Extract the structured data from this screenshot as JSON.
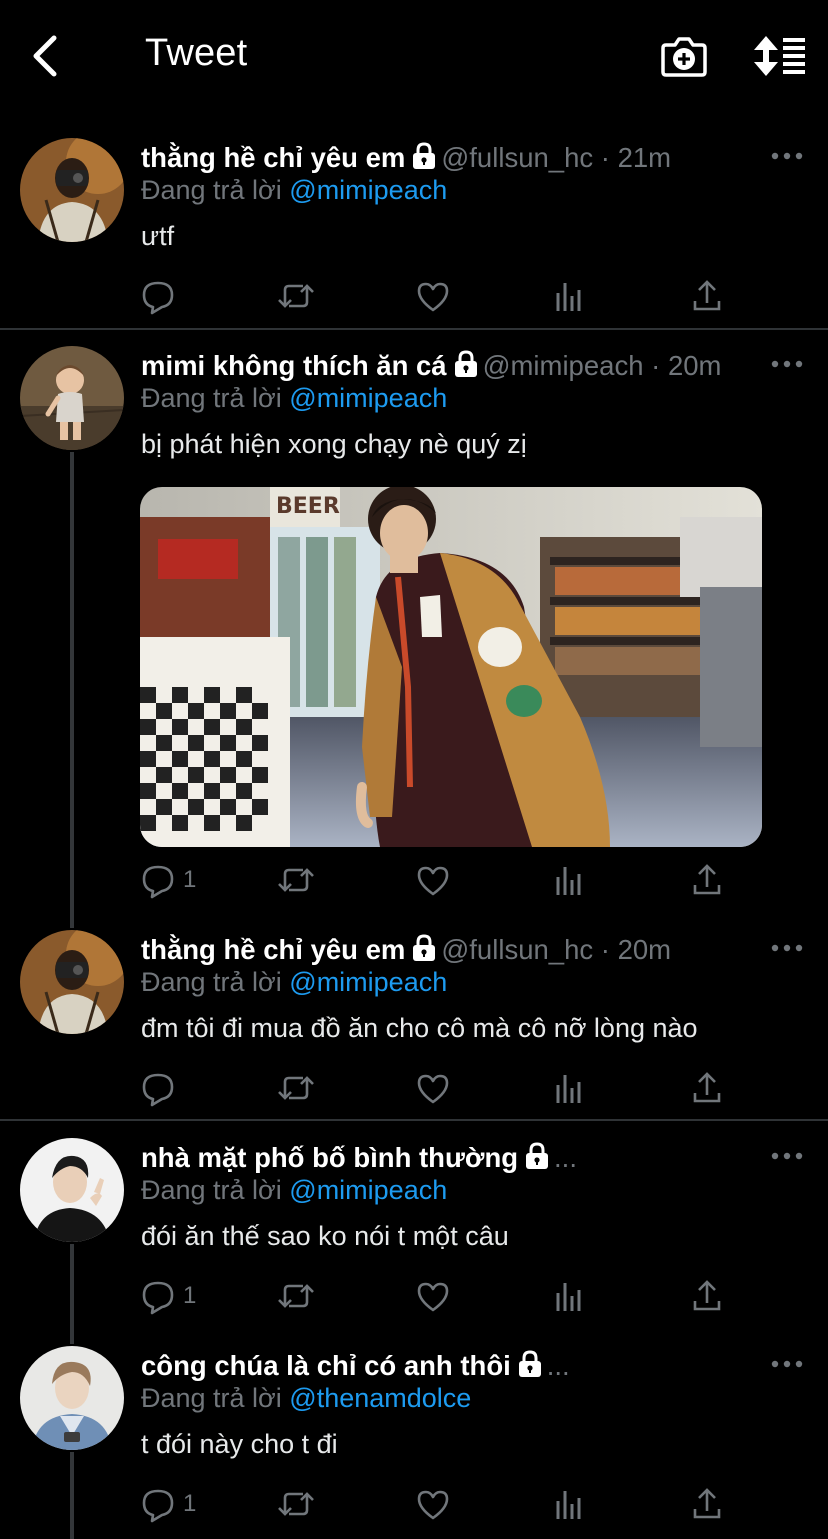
{
  "header": {
    "title": "Tweet"
  },
  "tweets": [
    {
      "display_name": "thằng hề chỉ yêu em",
      "handle": "@fullsun_hc",
      "time": "· 21m",
      "replying_prefix": "Đang trả lời",
      "replying_to": "@mimipeach",
      "text": "ưtf",
      "reply_count": ""
    },
    {
      "display_name": "mimi không thích ăn cá",
      "handle": "@mimipeach",
      "time": "· 20m",
      "replying_prefix": "Đang trả lời",
      "replying_to": "@mimipeach",
      "text": "bị phát hiện xong chạy nè quý zị",
      "reply_count": "1"
    },
    {
      "display_name": "thằng hề chỉ yêu em",
      "handle": "@fullsun_hc",
      "time": "· 20m",
      "replying_prefix": "Đang trả lời",
      "replying_to": "@mimipeach",
      "text": "đm tôi đi mua đồ ăn cho cô mà cô nỡ lòng nào",
      "reply_count": ""
    },
    {
      "display_name": "nhà mặt phố bố bình thường",
      "truncation": "...",
      "replying_prefix": "Đang trả lời",
      "replying_to": "@mimipeach",
      "text": "đói ăn thế sao ko nói t một câu",
      "reply_count": "1"
    },
    {
      "display_name": "công chúa là chỉ có anh thôi",
      "truncation": "...",
      "replying_prefix": "Đang trả lời",
      "replying_to": "@thenamdolce",
      "text": "t đói này cho t đi",
      "reply_count": "1"
    }
  ],
  "colors": {
    "background": "#000000",
    "text": "#e7e9ea",
    "secondary": "#71767b",
    "accent": "#1d9bf0",
    "divider": "#2f3336"
  }
}
